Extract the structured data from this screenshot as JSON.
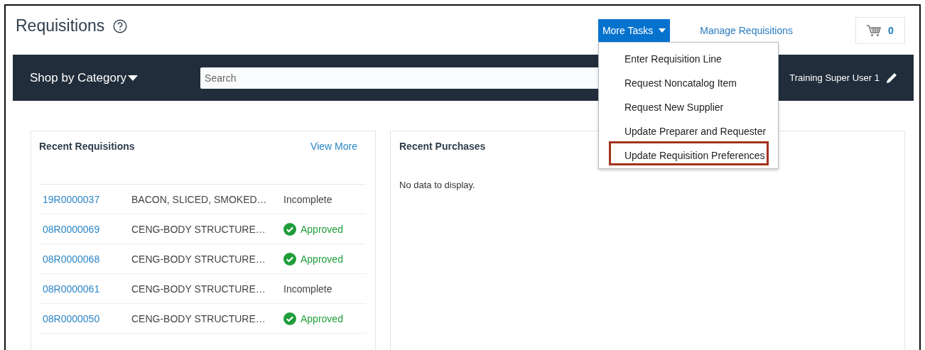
{
  "page": {
    "title": "Requisitions"
  },
  "header": {
    "more_tasks": "More Tasks",
    "manage_link": "Manage Requisitions",
    "cart_count": "0"
  },
  "more_tasks_menu": [
    {
      "label": "Enter Requisition Line",
      "selected": false
    },
    {
      "label": "Request Noncatalog Item",
      "selected": false
    },
    {
      "label": "Request New Supplier",
      "selected": false
    },
    {
      "label": "Update Preparer and Requester",
      "selected": false
    },
    {
      "label": "Update Requisition Preferences",
      "selected": true
    }
  ],
  "shop_bar": {
    "category": "Shop by Category",
    "search": {
      "placeholder": "Search"
    },
    "user": "Training Super User 1"
  },
  "recent_requisitions": {
    "title": "Recent Requisitions",
    "view_more": "View More",
    "rows": [
      {
        "number": "19R0000037",
        "description": "BACON, SLICED, SMOKED…",
        "status": "Incomplete",
        "kind": "incomplete"
      },
      {
        "number": "08R0000069",
        "description": "CENG-BODY STRUCTURE…",
        "status": "Approved",
        "kind": "approved"
      },
      {
        "number": "08R0000068",
        "description": "CENG-BODY STRUCTURE…",
        "status": "Approved",
        "kind": "approved"
      },
      {
        "number": "08R0000061",
        "description": "CENG-BODY STRUCTURE…",
        "status": "Incomplete",
        "kind": "incomplete"
      },
      {
        "number": "08R0000050",
        "description": "CENG-BODY STRUCTURE…",
        "status": "Approved",
        "kind": "approved"
      }
    ]
  },
  "recent_purchases": {
    "title": "Recent Purchases",
    "empty_message": "No data to display."
  }
}
